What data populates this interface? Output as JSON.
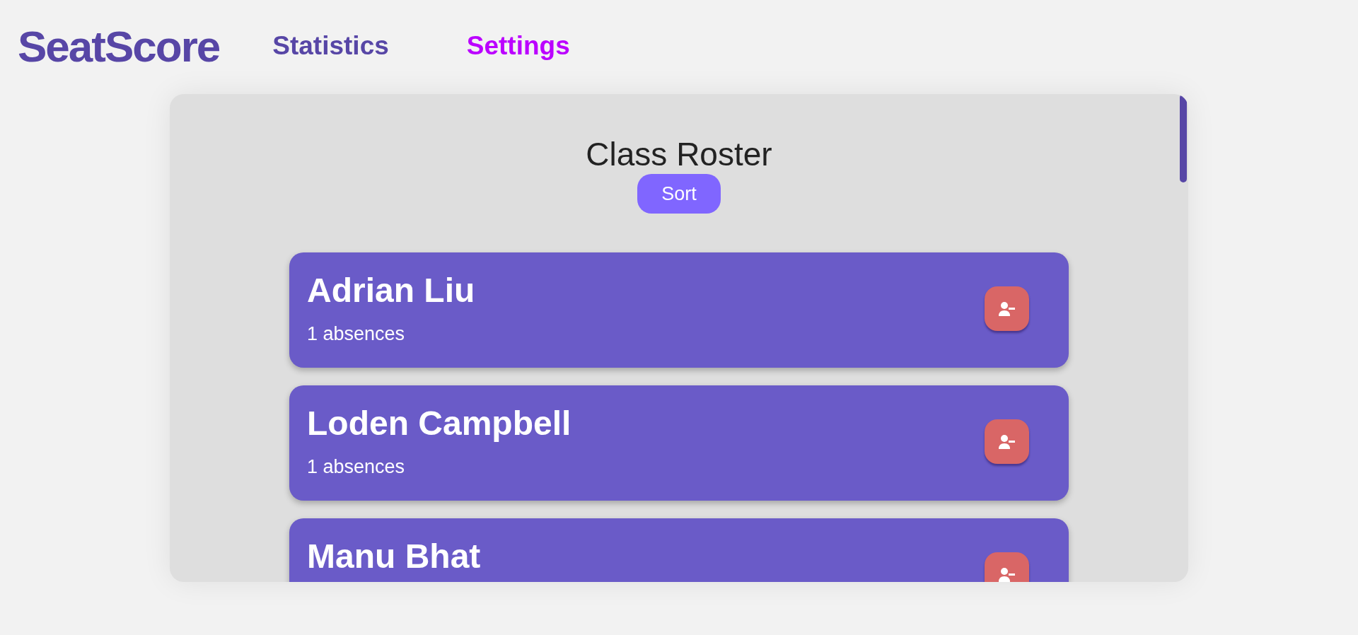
{
  "logo": "SeatScore",
  "nav": [
    {
      "label": "Statistics",
      "selected": false
    },
    {
      "label": "Settings",
      "selected": true
    }
  ],
  "roster": {
    "title": "Class Roster",
    "sort_button": "Sort",
    "students": [
      {
        "name": "Adrian Liu",
        "absences": "1 absences"
      },
      {
        "name": "Loden Campbell",
        "absences": "1 absences"
      },
      {
        "name": "Manu Bhat"
      }
    ]
  }
}
